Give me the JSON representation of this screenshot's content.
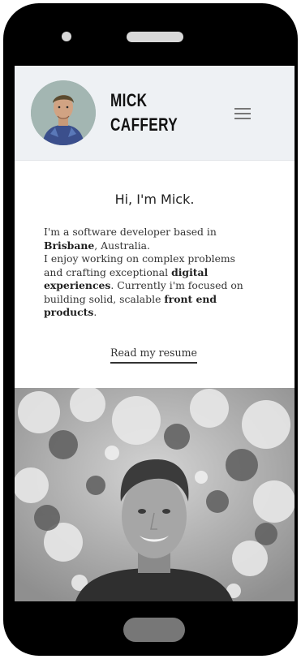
{
  "header": {
    "name_line1": "MICK",
    "name_line2": "CAFFERY",
    "avatar_icon": "avatar-illustration",
    "menu_icon": "hamburger-menu-icon"
  },
  "intro": {
    "greeting": "Hi, I'm Mick.",
    "bio": {
      "t1": "I'm a software developer based in ",
      "city": "Brisbane",
      "t2": ", Australia.",
      "t3": "I enjoy working on complex problems and crafting exceptional ",
      "em1": "digital experiences",
      "t4": ". Currently i'm focused on building solid, scalable ",
      "em2": "front end products",
      "t5": "."
    },
    "resume_link": "Read my resume"
  },
  "colors": {
    "phone_frame": "#000000",
    "header_bg": "#eef1f4",
    "text": "#333333"
  }
}
